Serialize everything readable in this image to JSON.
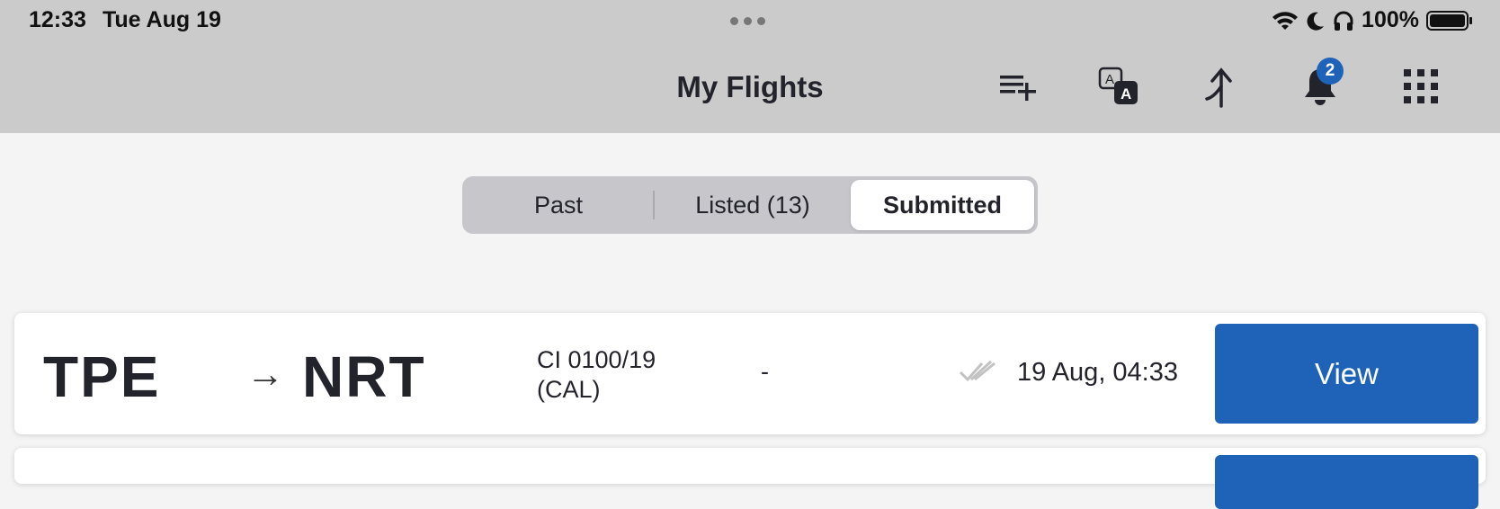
{
  "status_bar": {
    "time": "12:33",
    "date": "Tue Aug 19",
    "battery": "100%"
  },
  "header": {
    "title": "My Flights",
    "notification_count": "2",
    "icons": [
      "add-list-icon",
      "translate-icon",
      "merge-arrow-icon",
      "bell-icon",
      "grid-menu-icon"
    ]
  },
  "tabs": [
    {
      "label": "Past",
      "active": false
    },
    {
      "label": "Listed (13)",
      "active": false
    },
    {
      "label": "Submitted",
      "active": true
    }
  ],
  "flights": [
    {
      "origin": "TPE",
      "arrow": "→",
      "destination": "NRT",
      "flight_number": "CI 0100/19",
      "airline": "(CAL)",
      "extra": "-",
      "status_icon": "double-check-icon",
      "datetime": "19 Aug, 04:33",
      "action": "View"
    }
  ],
  "colors": {
    "accent": "#1f63b8",
    "header_bg": "#cbcbcb",
    "page_bg": "#f4f4f4"
  }
}
